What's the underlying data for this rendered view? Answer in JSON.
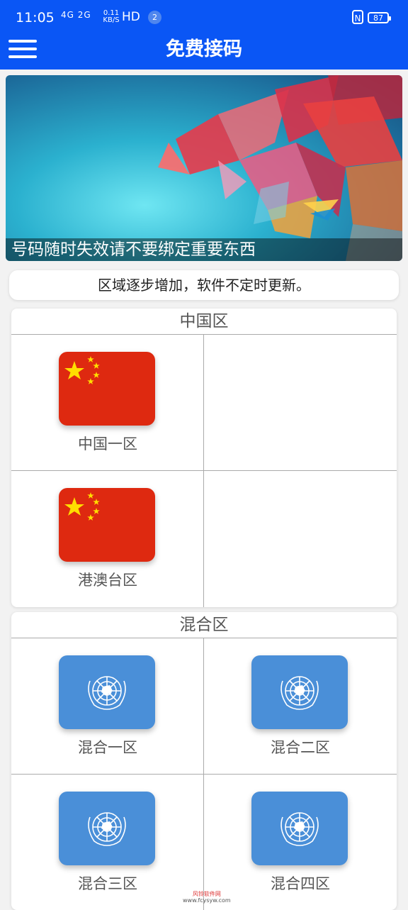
{
  "status_bar": {
    "time": "11:05",
    "signal": "4G 2G",
    "net_speed": "0.11 KB/S",
    "hd": "HD",
    "notification_count": "2",
    "nfc": "N",
    "battery": "87"
  },
  "app_bar": {
    "title": "免费接码"
  },
  "banner": {
    "caption": "号码随时失效请不要绑定重要东西"
  },
  "notice": "区域逐步增加，软件不定时更新。",
  "sections": [
    {
      "title": "中国区",
      "items": [
        {
          "label": "中国一区",
          "flag": "china-flag"
        },
        {
          "label": "港澳台区",
          "flag": "china-flag"
        }
      ]
    },
    {
      "title": "混合区",
      "items": [
        {
          "label": "混合一区",
          "flag": "un-flag"
        },
        {
          "label": "混合二区",
          "flag": "un-flag"
        },
        {
          "label": "混合三区",
          "flag": "un-flag"
        },
        {
          "label": "混合四区",
          "flag": "un-flag"
        }
      ]
    }
  ],
  "watermark": {
    "line1": "风铃软件网",
    "line2": "www.fcysyw.com"
  },
  "colors": {
    "primary": "#0a56f5",
    "china_red": "#de2910",
    "un_blue": "#4a8fd8"
  }
}
